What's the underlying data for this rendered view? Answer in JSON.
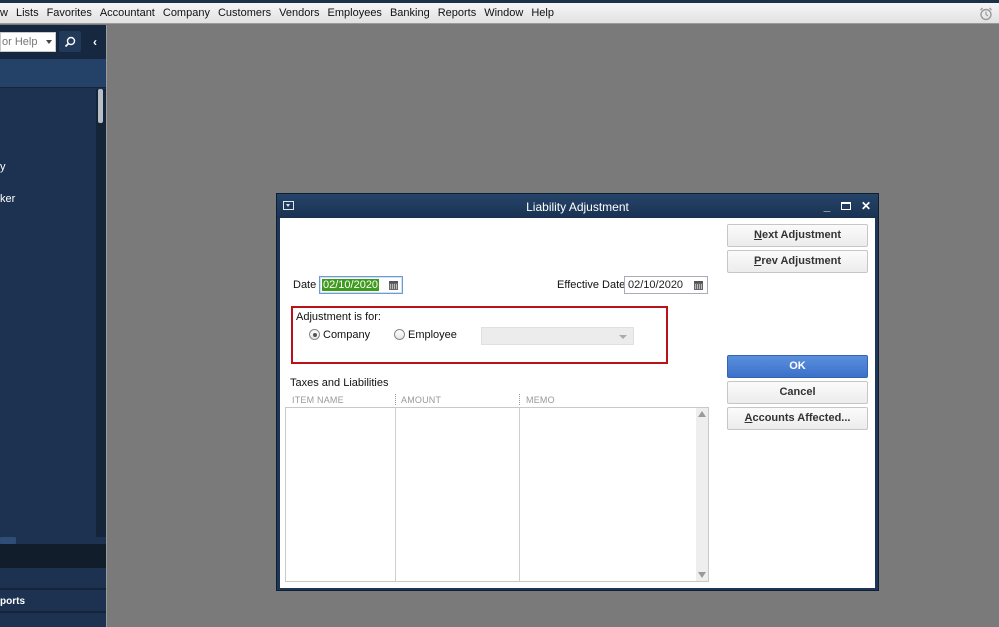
{
  "menubar": {
    "items": [
      {
        "label": "w"
      },
      {
        "label": "Lists"
      },
      {
        "label": "Favorites"
      },
      {
        "label": "Accountant"
      },
      {
        "label": "Company"
      },
      {
        "label": "Customers"
      },
      {
        "label": "Vendors"
      },
      {
        "label": "Employees"
      },
      {
        "label": "Banking"
      },
      {
        "label": "Reports"
      },
      {
        "label": "Window"
      },
      {
        "label": "Help"
      }
    ],
    "alarm_icon": "alarm-clock-icon"
  },
  "sidebar": {
    "search_placeholder": "or Help",
    "search_icon": "search-icon",
    "collapse_icon": "chevron-left-icon",
    "items": [
      {
        "label": "y"
      },
      {
        "label": "ker"
      }
    ],
    "bottom_item": "ports"
  },
  "dialog": {
    "title": "Liability Adjustment",
    "date_label": "Date",
    "date_value": "02/10/2020",
    "effective_date_label": "Effective Date",
    "effective_date_value": "02/10/2020",
    "adjustment_for_label": "Adjustment is for:",
    "radio_company": "Company",
    "radio_employee": "Employee",
    "selected_radio": "Company",
    "employee_combo_value": "",
    "taxes_label": "Taxes and Liabilities",
    "columns": [
      "ITEM NAME",
      "AMOUNT",
      "MEMO"
    ],
    "rows": [],
    "buttons": {
      "next": {
        "mnemonic": "N",
        "rest": "ext Adjustment"
      },
      "prev": {
        "mnemonic": "P",
        "rest": "rev Adjustment"
      },
      "ok": "OK",
      "cancel": "Cancel",
      "accounts": {
        "mnemonic": "A",
        "rest": "ccounts Affected..."
      }
    }
  }
}
